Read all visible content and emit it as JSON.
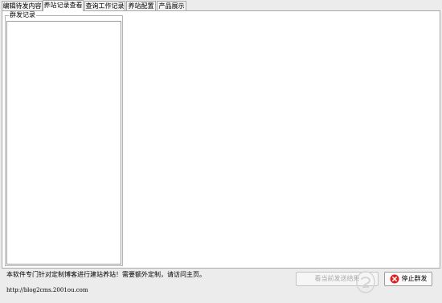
{
  "tabs": [
    {
      "label": "编辑待发内容"
    },
    {
      "label": "养站记录查看"
    },
    {
      "label": "查询工作记录"
    },
    {
      "label": "养站配置"
    },
    {
      "label": "产品展示"
    }
  ],
  "active_tab": "养站记录查看",
  "group": {
    "title": "群发记录"
  },
  "footer": {
    "notice": "本软件专门针对定制博客进行建站养站！需要额外定制，请访问主页。",
    "link": "http://blog2cms.2001ou.com"
  },
  "buttons": {
    "view_result": "看当前发送结果",
    "stop": "停止群发"
  },
  "icons": {
    "stop": "stop-x-icon",
    "watermark": "watermark-logo-icon"
  },
  "colors": {
    "stop_icon": "#e02020",
    "panel_bg": "#ffffff",
    "window_bg": "#ececec"
  }
}
